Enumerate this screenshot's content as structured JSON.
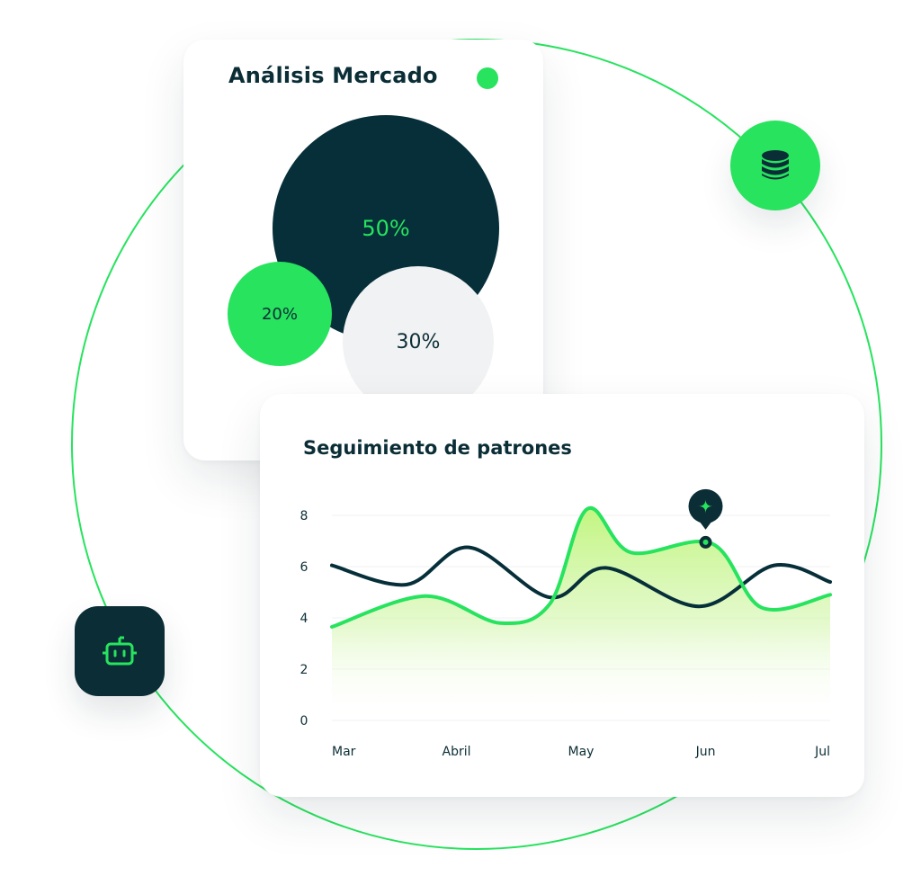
{
  "colors": {
    "accent_green": "#27e35e",
    "dark_teal": "#062f39",
    "light_gray": "#f1f2f3",
    "text_dark": "#0b2e36"
  },
  "icons": {
    "database": "database-icon",
    "robot": "robot-icon",
    "marker": "sparkle-icon"
  },
  "market": {
    "title": "Análisis Mercado"
  },
  "patterns": {
    "title": "Seguimiento de patrones"
  },
  "chart_data": [
    {
      "type": "bubble",
      "title": "Análisis Mercado",
      "values": [
        {
          "label": "50%",
          "value": 50,
          "color": "#062f39"
        },
        {
          "label": "30%",
          "value": 30,
          "color": "#f1f2f3"
        },
        {
          "label": "20%",
          "value": 20,
          "color": "#27e35e"
        }
      ]
    },
    {
      "type": "line",
      "title": "Seguimiento de patrones",
      "categories": [
        "Mar",
        "Abril",
        "May",
        "Jun",
        "Jul"
      ],
      "yticks": [
        0,
        2,
        4,
        6,
        8
      ],
      "ylim": [
        0,
        8
      ],
      "grid": true,
      "series": [
        {
          "color": "#062f39",
          "points": [
            {
              "x": 0,
              "y": 6.05
            },
            {
              "x": 0.6,
              "y": 5.3
            },
            {
              "x": 1.1,
              "y": 6.75
            },
            {
              "x": 1.75,
              "y": 4.8
            },
            {
              "x": 2.2,
              "y": 5.95
            },
            {
              "x": 2.95,
              "y": 4.45
            },
            {
              "x": 3.55,
              "y": 6.05
            },
            {
              "x": 4,
              "y": 5.4
            }
          ]
        },
        {
          "color": "#27e35e",
          "area": true,
          "points": [
            {
              "x": 0,
              "y": 3.65
            },
            {
              "x": 0.75,
              "y": 4.85
            },
            {
              "x": 1.35,
              "y": 3.8
            },
            {
              "x": 1.75,
              "y": 4.55
            },
            {
              "x": 2.05,
              "y": 8.25
            },
            {
              "x": 2.4,
              "y": 6.55
            },
            {
              "x": 3.05,
              "y": 6.9
            },
            {
              "x": 3.45,
              "y": 4.4
            },
            {
              "x": 4,
              "y": 4.9
            }
          ]
        }
      ],
      "marker": {
        "x": 3,
        "y": 6.95
      }
    }
  ]
}
